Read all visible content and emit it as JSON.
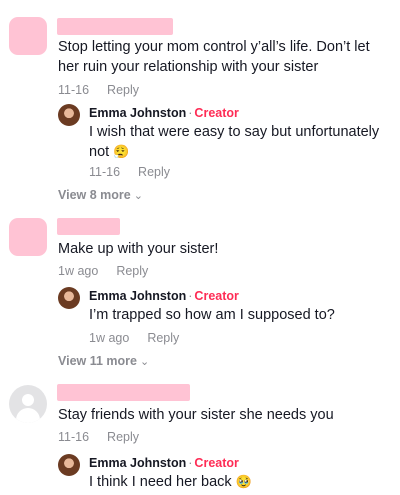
{
  "creator_label": "Creator",
  "reply_label": "Reply",
  "dot": "·",
  "comments": [
    {
      "text": "Stop letting your mom control y’all’s life. Don’t let her ruin your relationship with your sister",
      "date": "11-16",
      "reply": {
        "author": "Emma Johnston",
        "text": "I wish that were easy to say but unfortunately not",
        "emoji": "😮‍💨",
        "date": "11-16"
      },
      "view_more": "View 8 more"
    },
    {
      "text": "Make up with your sister!",
      "date": "1w ago",
      "reply": {
        "author": "Emma Johnston",
        "text": "I’m trapped so how am I supposed to?",
        "date": "1w ago"
      },
      "view_more": "View 11 more"
    },
    {
      "text": "Stay friends with your sister she needs you",
      "date": "11-16",
      "reply": {
        "author": "Emma Johnston",
        "text": "I think I need her back",
        "emoji": "🥹"
      }
    }
  ],
  "icons": {
    "chevron": "⌄"
  }
}
